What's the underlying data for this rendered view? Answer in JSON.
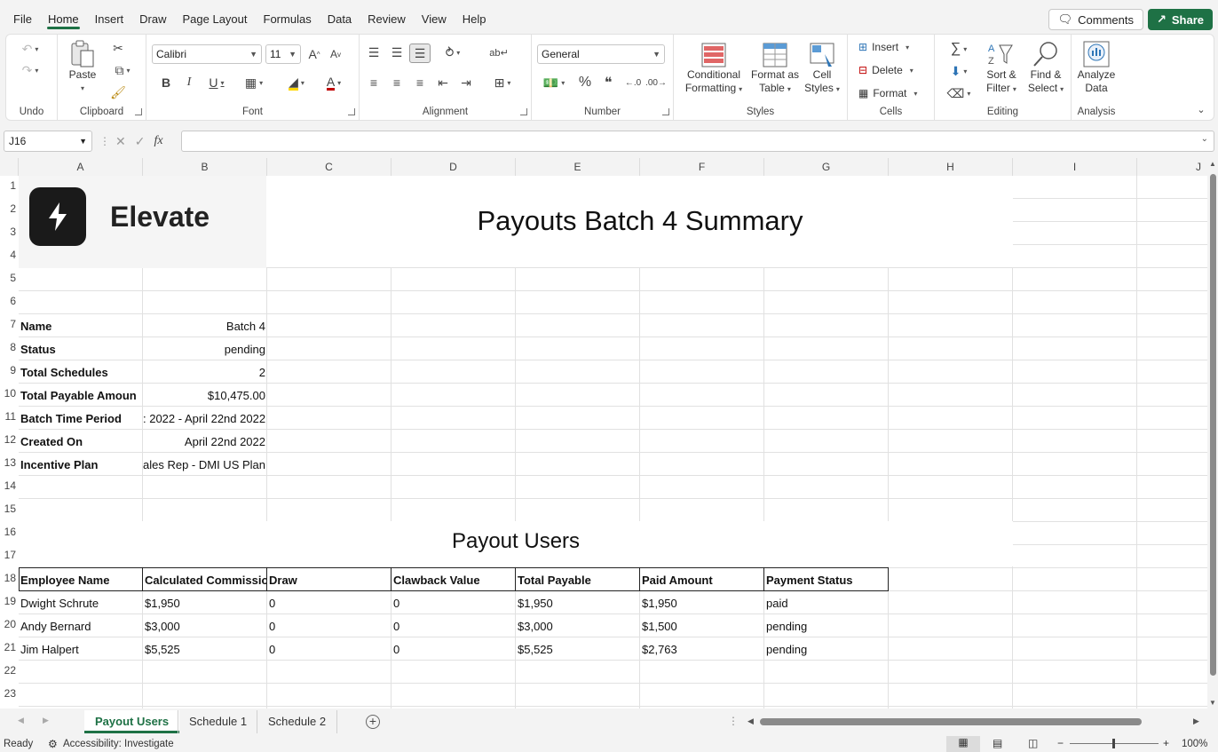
{
  "menu": {
    "items": [
      "File",
      "Home",
      "Insert",
      "Draw",
      "Page Layout",
      "Formulas",
      "Data",
      "Review",
      "View",
      "Help"
    ],
    "active": "Home",
    "comments_label": "Comments",
    "share_label": "Share"
  },
  "ribbon": {
    "undo_label": "Undo",
    "clipboard_label": "Clipboard",
    "paste_label": "Paste",
    "font_label": "Font",
    "font_name": "Calibri",
    "font_size": "11",
    "alignment_label": "Alignment",
    "number_label": "Number",
    "number_format": "General",
    "styles_label": "Styles",
    "conditional_formatting": [
      "Conditional",
      "Formatting"
    ],
    "format_as_table": [
      "Format as",
      "Table"
    ],
    "cell_styles": [
      "Cell",
      "Styles"
    ],
    "cells_label": "Cells",
    "insert_label": "Insert",
    "delete_label": "Delete",
    "format_label": "Format",
    "editing_label": "Editing",
    "sort_filter": [
      "Sort &",
      "Filter"
    ],
    "find_select": [
      "Find &",
      "Select"
    ],
    "analysis_label": "Analysis",
    "analyze_data": [
      "Analyze",
      "Data"
    ]
  },
  "formula_bar": {
    "name_box": "J16",
    "formula": ""
  },
  "grid": {
    "columns": [
      "A",
      "B",
      "C",
      "D",
      "E",
      "F",
      "G",
      "H",
      "I",
      "J"
    ],
    "rows": [
      "1",
      "2",
      "3",
      "4",
      "5",
      "6",
      "7",
      "8",
      "9",
      "10",
      "11",
      "12",
      "13",
      "14",
      "15",
      "16",
      "17",
      "18",
      "19",
      "20",
      "21",
      "22",
      "23"
    ]
  },
  "sheet": {
    "logo_text": "Elevate",
    "title": "Payouts Batch 4 Summary",
    "summary": [
      {
        "label": "Name",
        "value": "Batch 4"
      },
      {
        "label": "Status",
        "value": "pending"
      },
      {
        "label": "Total Schedules",
        "value": "2"
      },
      {
        "label": "Total Payable Amoun",
        "value": "$10,475.00"
      },
      {
        "label": "Batch Time Period",
        "value": ": 2022 - April 22nd 2022"
      },
      {
        "label": "Created On",
        "value": "April 22nd 2022"
      },
      {
        "label": "Incentive Plan",
        "value": "ales Rep - DMI US Plan"
      }
    ],
    "users_title": "Payout Users",
    "table_headers": [
      "Employee Name",
      "Calculated Commissio",
      "Draw",
      "Clawback Value",
      "Total Payable",
      "Paid Amount",
      "Payment Status"
    ],
    "table_rows": [
      [
        "Dwight Schrute",
        "$1,950",
        "0",
        "0",
        "$1,950",
        "$1,950",
        "paid"
      ],
      [
        "Andy Bernard",
        "$3,000",
        "0",
        "0",
        "$3,000",
        "$1,500",
        "pending"
      ],
      [
        "Jim Halpert",
        "$5,525",
        "0",
        "0",
        "$5,525",
        "$2,763",
        "pending"
      ]
    ]
  },
  "tabs": {
    "sheets": [
      "Payout Users",
      "Schedule 1",
      "Schedule 2"
    ],
    "active": "Payout Users"
  },
  "status": {
    "ready": "Ready",
    "accessibility": "Accessibility: Investigate",
    "zoom": "100%"
  },
  "colors": {
    "accent": "#1e7145"
  }
}
